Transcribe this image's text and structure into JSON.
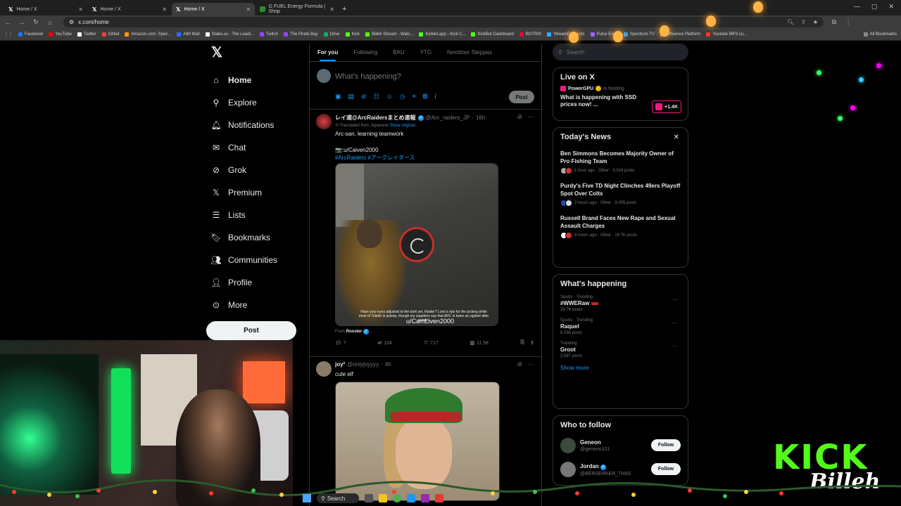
{
  "browser": {
    "tabs": [
      {
        "title": "Home / X",
        "active": false
      },
      {
        "title": "Home / X",
        "active": false
      },
      {
        "title": "Home / X",
        "active": true
      },
      {
        "title": "G FUEL Energy Formula | Shop",
        "active": false
      }
    ],
    "url": "x.com/home",
    "bookmarks": [
      "Facebook",
      "YouTube",
      "Twitter",
      "GMail",
      "Amazon.com: Spec...",
      "AIM Mail",
      "Stake.us - The Leadi...",
      "Twitch",
      "The Pirate Bay",
      "Drive",
      "Kick",
      "Billeh Stream - Watc...",
      "Kicklet.app - Kick C...",
      "KickBot Dashboard",
      "BOTRIX",
      "StreamElements",
      "Pulse Expo",
      "Spectrum TV",
      "Influence Platform",
      "Youtube MP3 co..."
    ],
    "all_bookmarks": "All Bookmarks"
  },
  "nav": {
    "items": [
      {
        "label": "Home",
        "icon": "home-icon"
      },
      {
        "label": "Explore",
        "icon": "search-icon"
      },
      {
        "label": "Notifications",
        "icon": "bell-icon"
      },
      {
        "label": "Chat",
        "icon": "mail-icon"
      },
      {
        "label": "Grok",
        "icon": "grok-icon"
      },
      {
        "label": "Premium",
        "icon": "x-logo-icon"
      },
      {
        "label": "Lists",
        "icon": "list-icon"
      },
      {
        "label": "Bookmarks",
        "icon": "bookmark-icon"
      },
      {
        "label": "Communities",
        "icon": "people-icon"
      },
      {
        "label": "Profile",
        "icon": "person-icon"
      },
      {
        "label": "More",
        "icon": "more-circle-icon"
      }
    ],
    "post_label": "Post"
  },
  "feed": {
    "tabs": [
      "For you",
      "Following",
      "BAU",
      "YTG",
      "Nextdoor Steppas"
    ],
    "composer_placeholder": "What's happening?",
    "composer_post": "Post",
    "tweets": [
      {
        "name": "レイ速@ArcRaidersまとめ速報",
        "handle": "@Arc_raiders_JP",
        "time": "16h",
        "translated": "Translated from Japanese",
        "show_original": "Show original",
        "text1": "Arc-san, learning teamwork",
        "text2": "📷:u/Caiven2000",
        "tags": "#ArcRaiders #アークレイダース",
        "caption": "Have your eyes adjusted to the dark yet, Raider? Loot is ripe for the picking while most of Toledo is asleep, though my suppliers say that ARC is twice as vigilant after sunset.",
        "watermark": "u/CamLiven2000",
        "from_label": "From",
        "from_name": "Rooster",
        "replies": "7",
        "reposts": "104",
        "likes": "717",
        "views": "11.5K"
      },
      {
        "name": "joy²",
        "handle": "@onlyjoyyyy",
        "time": "4h",
        "text1": "cute elf"
      }
    ]
  },
  "sidebar": {
    "search_placeholder": "Search",
    "live": {
      "title": "Live on X",
      "host": "PowerGPU",
      "hosting": "is hosting",
      "headline": "What is happening with SSD prices now! ...",
      "listeners": "+1.4K"
    },
    "news": {
      "title": "Today's News",
      "items": [
        {
          "headline": "Ben Simmons Becomes Majority Owner of Pro Fishing Team",
          "meta": "1 hour ago · Other · 3,024 posts"
        },
        {
          "headline": "Purdy's Five TD Night Clinches 49ers Playoff Spot Over Colts",
          "meta": "2 hours ago · Other · 9,005 posts"
        },
        {
          "headline": "Russell Brand Faces New Rape and Sexual Assault Charges",
          "meta": "3 hours ago · Other · 19.7K posts"
        }
      ]
    },
    "happening": {
      "title": "What's happening",
      "trends": [
        {
          "context": "Sports · Trending",
          "name": "#WWERaw",
          "count": "29.7K posts"
        },
        {
          "context": "Sports · Trending",
          "name": "Raquel",
          "count": "6,056 posts"
        },
        {
          "context": "Trending",
          "name": "Groot",
          "count": "3,587 posts"
        }
      ],
      "show_more": "Show more"
    },
    "who_to_follow": {
      "title": "Who to follow",
      "accounts": [
        {
          "name": "Geneon",
          "handle": "@geneon101",
          "button": "Follow"
        },
        {
          "name": "Jordan",
          "handle": "@BERSERKER_THIIS",
          "button": "Follow"
        }
      ]
    }
  },
  "overlay": {
    "kick_text": "KICK",
    "signature": "Billeh",
    "taskbar_search": "Search"
  },
  "colors": {
    "accent": "#1d9bf0",
    "kick_green": "#53fc18",
    "live_pink": "#f91880"
  }
}
